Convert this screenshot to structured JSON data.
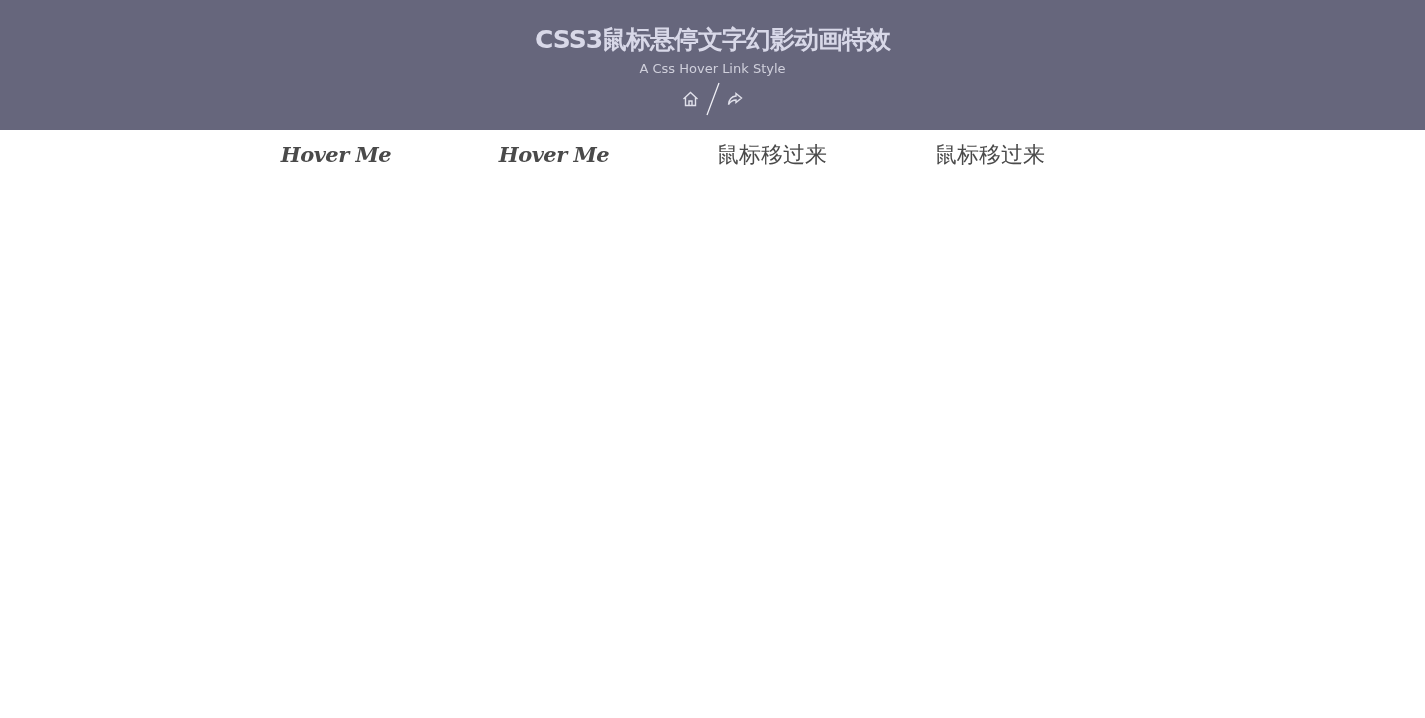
{
  "header": {
    "title": "CSS3鼠标悬停文字幻影动画特效",
    "subtitle": "A Css Hover Link Style"
  },
  "links": [
    {
      "label": "Hover Me",
      "kind": "script"
    },
    {
      "label": "Hover Me",
      "kind": "script"
    },
    {
      "label": "鼠标移过来",
      "kind": "plain"
    },
    {
      "label": "鼠标移过来",
      "kind": "plain"
    }
  ]
}
